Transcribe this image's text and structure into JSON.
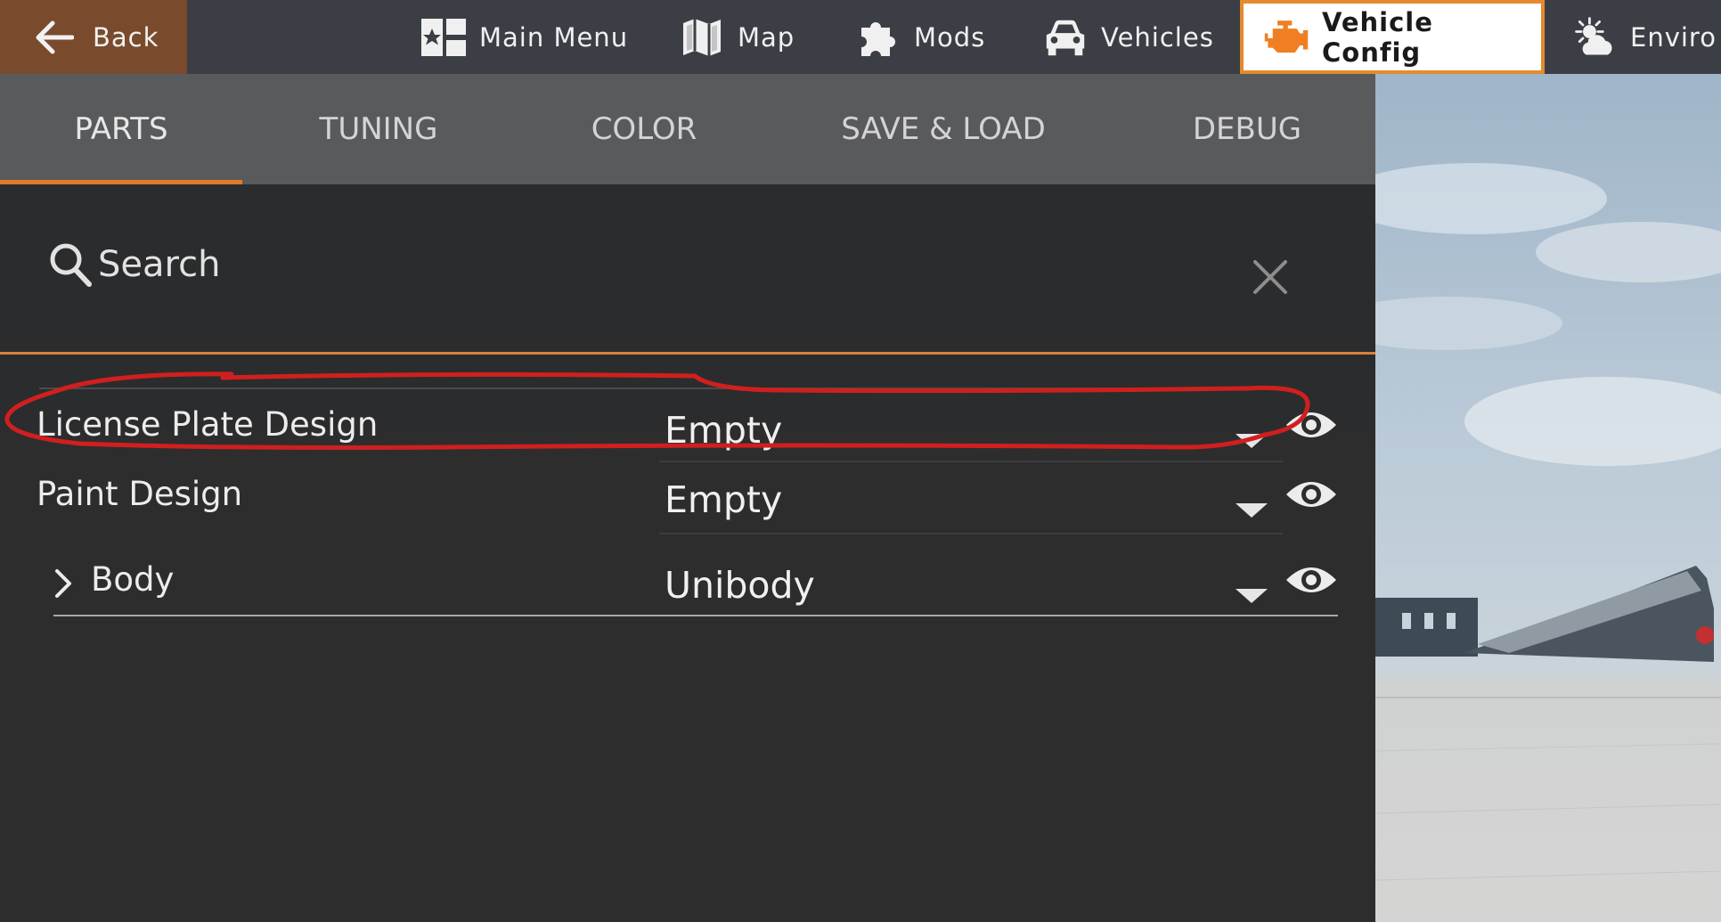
{
  "topbar": {
    "back_label": "Back",
    "nav": [
      {
        "label": "Main Menu",
        "icon": "main-menu-icon"
      },
      {
        "label": "Map",
        "icon": "map-icon"
      },
      {
        "label": "Mods",
        "icon": "puzzle-icon"
      },
      {
        "label": "Vehicles",
        "icon": "car-icon"
      },
      {
        "label": "Vehicle Config",
        "icon": "engine-icon",
        "active": true
      },
      {
        "label": "Enviro",
        "icon": "weather-icon"
      }
    ]
  },
  "tabs": [
    {
      "label": "PARTS",
      "active": true
    },
    {
      "label": "TUNING"
    },
    {
      "label": "COLOR"
    },
    {
      "label": "SAVE & LOAD"
    },
    {
      "label": "DEBUG"
    }
  ],
  "search": {
    "placeholder": "Search",
    "value": ""
  },
  "parts": [
    {
      "name": "License Plate Design",
      "value": "Empty",
      "highlighted": true
    },
    {
      "name": "Paint Design",
      "value": "Empty"
    },
    {
      "name": "Body",
      "value": "Unibody",
      "expandable": true
    }
  ],
  "colors": {
    "accent": "#e27a28",
    "annotation": "#d01f1f",
    "back_bg": "#7a4a2d",
    "topbar_bg": "#3b3f45",
    "tabs_bg": "#595a5c",
    "panel_bg": "#2d2d2e"
  }
}
